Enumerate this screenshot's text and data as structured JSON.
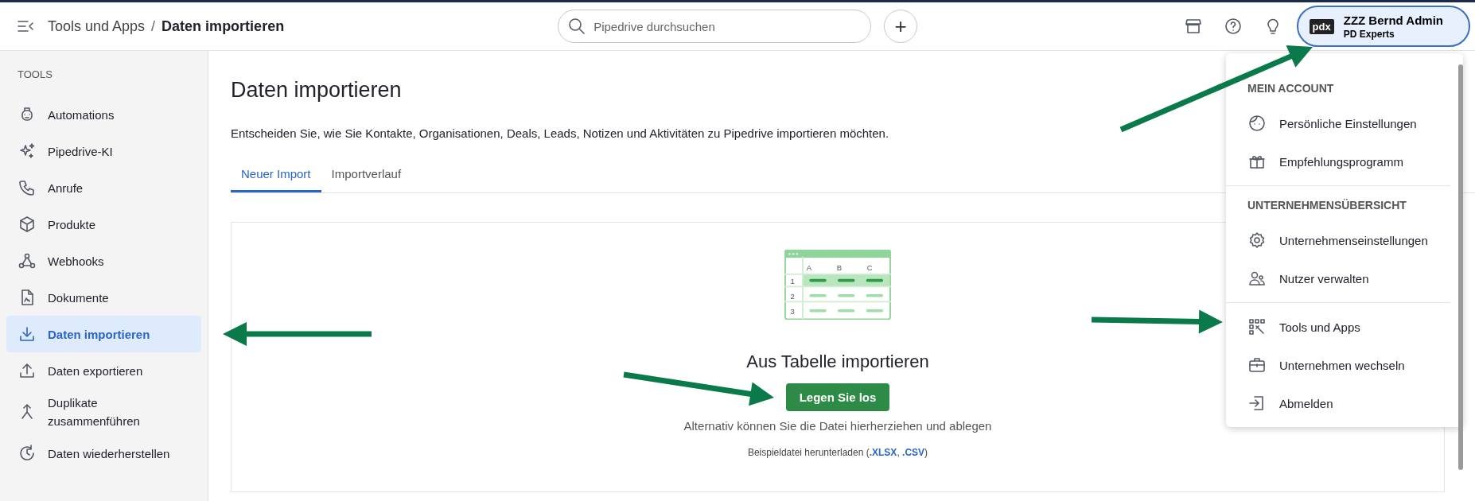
{
  "topbar": {
    "breadcrumb_separator": "/",
    "breadcrumb": [
      {
        "label": "Tools und Apps",
        "current": false
      },
      {
        "label": "Daten importieren",
        "current": true
      }
    ],
    "search": {
      "placeholder": "Pipedrive durchsuchen"
    },
    "add_button": "+",
    "account": {
      "logo": "pdx",
      "name": "ZZZ Bernd Admin",
      "company": "PD Experts",
      "open": true
    }
  },
  "sidebar": {
    "heading": "TOOLS",
    "items": [
      {
        "label": "Automations",
        "selected": false
      },
      {
        "label": "Pipedrive-KI",
        "selected": false
      },
      {
        "label": "Anrufe",
        "selected": false
      },
      {
        "label": "Produkte",
        "selected": false
      },
      {
        "label": "Webhooks",
        "selected": false
      },
      {
        "label": "Dokumente",
        "selected": false
      },
      {
        "label": "Daten importieren",
        "selected": true
      },
      {
        "label": "Daten exportieren",
        "selected": false
      },
      {
        "label": "Duplikate zusammenführen",
        "selected": false
      },
      {
        "label": "Daten wiederherstellen",
        "selected": false
      }
    ]
  },
  "main": {
    "title": "Daten importieren",
    "description": "Entscheiden Sie, wie Sie Kontakte, Organisationen, Deals, Leads, Notizen und Aktivitäten zu Pipedrive importieren möchten.",
    "tabs": [
      {
        "label": "Neuer Import",
        "selected": true
      },
      {
        "label": "Importverlauf",
        "selected": false
      }
    ],
    "card": {
      "illustration": {
        "columns": [
          "A",
          "B",
          "C"
        ],
        "rows": [
          "1",
          "2",
          "3"
        ]
      },
      "heading": "Aus Tabelle importieren",
      "button": "Legen Sie los",
      "hint": "Alternativ können Sie die Datei hierherziehen und ablegen",
      "sample": {
        "prefix": "Beispieldatei herunterladen (",
        "links": [
          ".XLSX",
          ".CSV"
        ],
        "separator": ", ",
        "suffix": ")"
      }
    }
  },
  "account_menu": {
    "sections": [
      {
        "heading": "MEIN ACCOUNT",
        "items": [
          "Persönliche Einstellungen",
          "Empfehlungsprogramm"
        ]
      },
      {
        "heading": "UNTERNEHMENSÜBERSICHT",
        "items": [
          "Unternehmenseinstellungen",
          "Nutzer verwalten"
        ]
      },
      {
        "items": [
          "Tools und Apps",
          "Unternehmen wechseln",
          "Abmelden"
        ]
      }
    ]
  }
}
